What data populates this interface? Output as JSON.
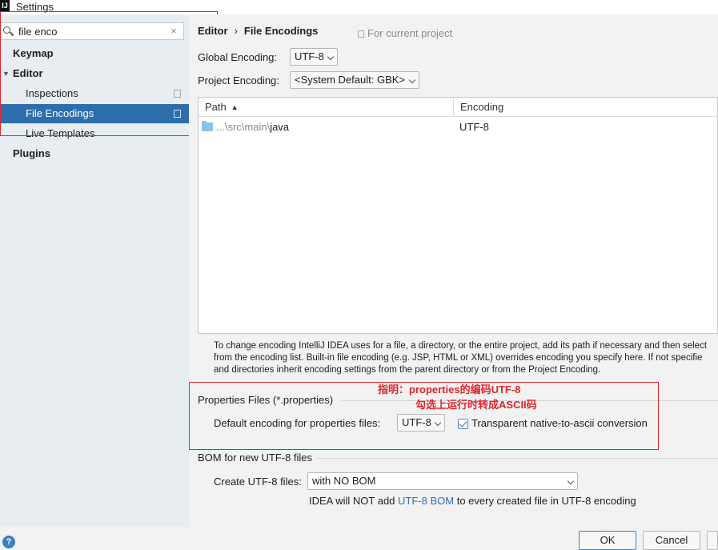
{
  "window": {
    "title": "Settings"
  },
  "sidebar": {
    "search": {
      "value": "file enco"
    },
    "items": [
      {
        "label": "Keymap"
      },
      {
        "label": "Editor"
      },
      {
        "label": "Inspections"
      },
      {
        "label": "File Encodings",
        "selected": true
      },
      {
        "label": "Live Templates"
      },
      {
        "label": "Plugins"
      }
    ]
  },
  "main": {
    "breadcrumb": {
      "parent": "Editor",
      "separator": "›",
      "current": "File Encodings"
    },
    "for_current_project": "For current project",
    "global_encoding": {
      "label": "Global Encoding:",
      "value": "UTF-8"
    },
    "project_encoding": {
      "label": "Project Encoding:",
      "value": "<System Default: GBK>"
    },
    "table": {
      "columns": [
        "Path",
        "Encoding"
      ],
      "rows": [
        {
          "path_prefix": "...\\src\\main\\",
          "path_last": "java",
          "encoding": "UTF-8"
        }
      ]
    },
    "info_lines": [
      "To change encoding IntelliJ IDEA uses for a file, a directory, or the entire project, add its path if necessary and then select",
      "from the encoding list. Built-in file encoding (e.g. JSP, HTML or XML) overrides encoding you specify here. If not specifie",
      "and directories inherit encoding settings from the parent directory or from the Project Encoding."
    ],
    "properties": {
      "title": "Properties Files (*.properties)",
      "default_label": "Default encoding for properties files:",
      "default_value": "UTF-8",
      "transparent_label": "Transparent native-to-ascii conversion",
      "transparent_checked": true
    },
    "annotations": {
      "line1": "指明：properties的编码UTF-8",
      "line2": "勾选上运行时转成ASCII码"
    },
    "bom": {
      "title": "BOM for new UTF-8 files",
      "create_label": "Create UTF-8 files:",
      "create_value": "with NO BOM",
      "note_prefix": "IDEA will NOT add ",
      "note_link": "UTF-8 BOM",
      "note_suffix": " to every created file in UTF-8 encoding"
    }
  },
  "footer": {
    "help": "?",
    "ok": "OK",
    "cancel": "Cancel"
  },
  "colors": {
    "selection": "#2f6ead",
    "annotation": "#e0252b",
    "link": "#2f6ead"
  }
}
